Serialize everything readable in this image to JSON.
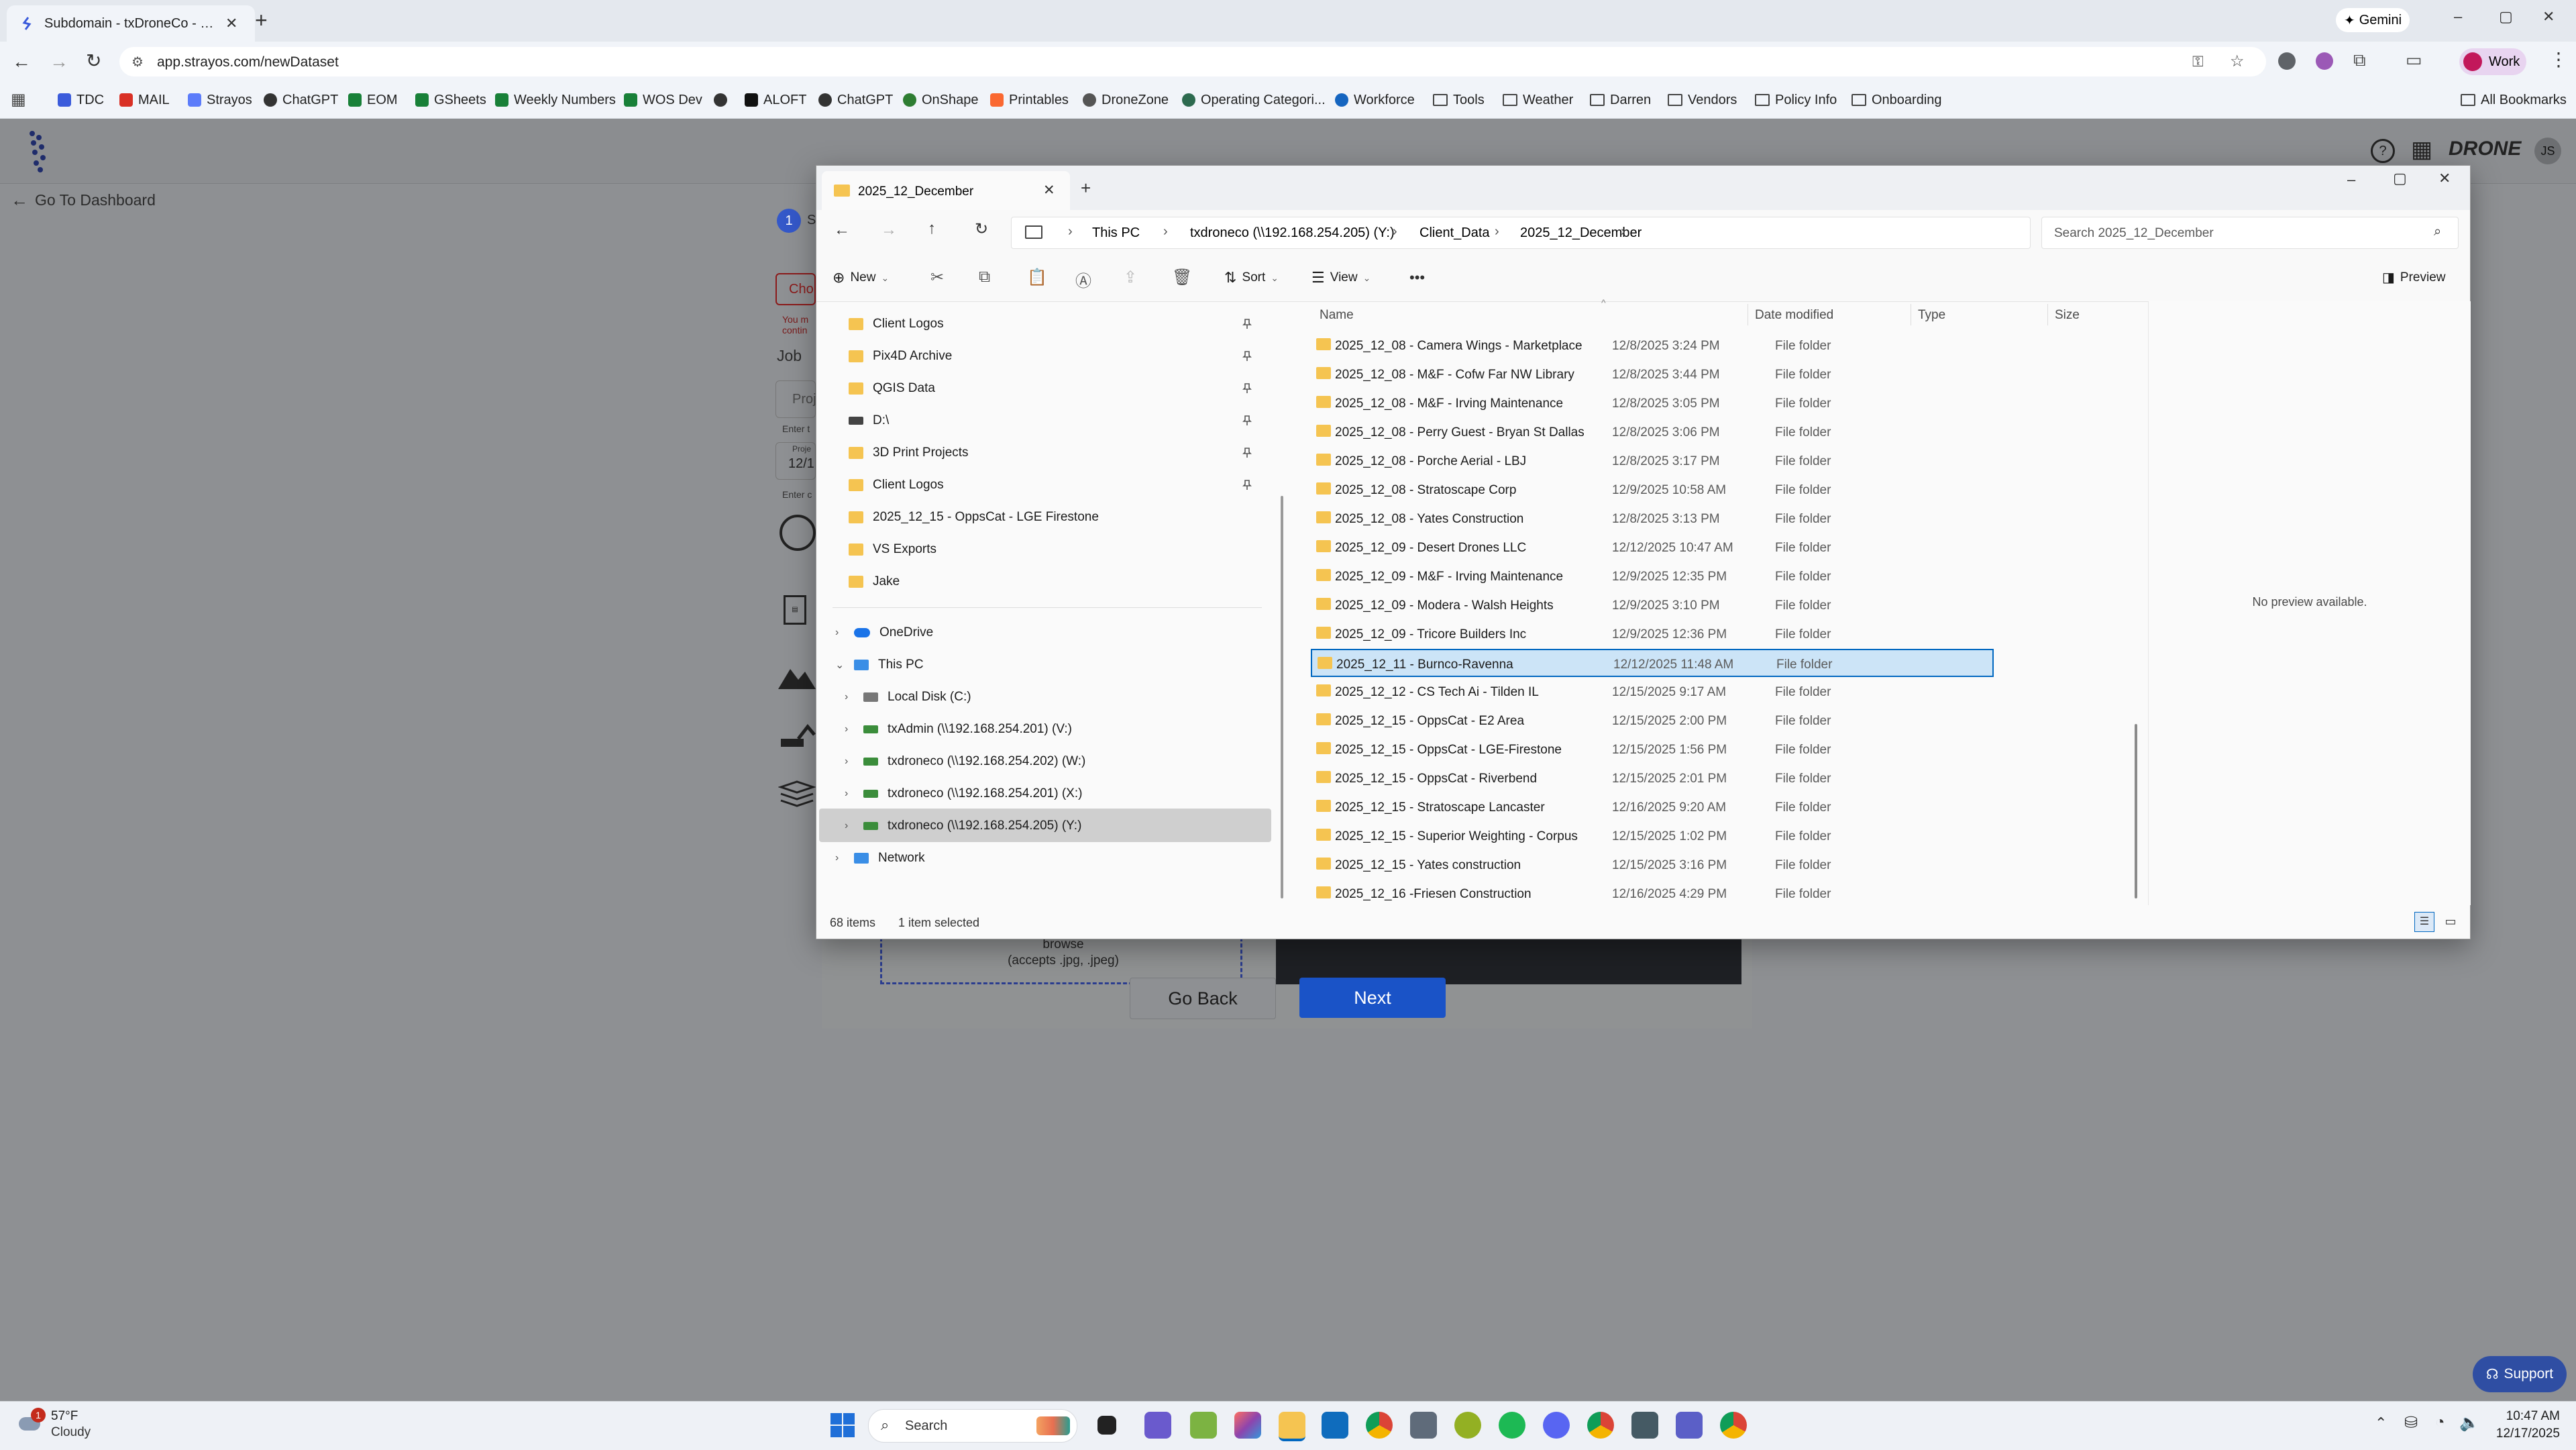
{
  "browser": {
    "tab_title": "Subdomain - txDroneCo - Dem",
    "new_tab_symbol": "+",
    "gemini_label": "Gemini",
    "url": "app.strayos.com/newDataset",
    "profile_label": "Work",
    "window_controls": [
      "–",
      "▢",
      "✕"
    ],
    "bookmarks": [
      "TDC",
      "MAIL",
      "Strayos",
      "ChatGPT",
      "EOM",
      "GSheets",
      "Weekly Numbers",
      "WOS Dev",
      "ALOFT",
      "ChatGPT",
      "OnShape",
      "Printables",
      "DroneZone",
      "Operating Categori...",
      "Workforce",
      "Tools",
      "Weather",
      "Darren",
      "Vendors",
      "Policy Info",
      "Onboarding"
    ],
    "all_bookmarks_label": "All Bookmarks"
  },
  "webpage": {
    "go_dashboard": "Go To Dashboard",
    "step_number": "1",
    "step_label_frag": "S",
    "choose_frag": "Cho",
    "warn_frag_1": "You m",
    "warn_frag_2": "contin",
    "job_label": "Job",
    "proj_placeholder_frag": "Proj",
    "enter_frag_1": "Enter t",
    "proj_label_frag": "Proje",
    "date_frag": "12/1",
    "enter_frag_2": "Enter c",
    "browse_label": "browse",
    "accepts_label": "(accepts .jpg, .jpeg)",
    "go_back_label": "Go Back",
    "next_label": "Next",
    "support_label": "Support",
    "drone_logo_text": "DRONE",
    "avatar_initials": "JS",
    "colors": {
      "accent": "#1a73e8",
      "dim_overlay": "#8e9093"
    }
  },
  "explorer": {
    "tab_title": "2025_12_December",
    "breadcrumb": [
      "This PC",
      "txdroneco (\\\\192.168.254.205) (Y:)",
      "Client_Data",
      "2025_12_December"
    ],
    "search_placeholder": "Search 2025_12_December",
    "commands": {
      "new": "New",
      "sort": "Sort",
      "view": "View",
      "more": "•••",
      "preview": "Preview"
    },
    "nav_pinned": [
      "Client Logos",
      "Pix4D Archive",
      "QGIS Data",
      "D:\\",
      "3D Print Projects",
      "Client Logos"
    ],
    "nav_recent": [
      "2025_12_15 - OppsCat - LGE Firestone",
      "VS Exports",
      "Jake"
    ],
    "nav_tree": [
      "OneDrive",
      "This PC",
      "Local Disk (C:)",
      "txAdmin (\\\\192.168.254.201) (V:)",
      "txdroneco (\\\\192.168.254.202) (W:)",
      "txdroneco (\\\\192.168.254.201) (X:)",
      "txdroneco (\\\\192.168.254.205) (Y:)",
      "Network"
    ],
    "columns": [
      "Name",
      "Date modified",
      "Type",
      "Size"
    ],
    "rows": [
      {
        "name": "2025_12_08 - Camera Wings - Marketplace",
        "date": "12/8/2025 3:24 PM",
        "type": "File folder"
      },
      {
        "name": "2025_12_08 - M&F - Cofw Far NW Library",
        "date": "12/8/2025 3:44 PM",
        "type": "File folder"
      },
      {
        "name": "2025_12_08 - M&F - Irving Maintenance",
        "date": "12/8/2025 3:05 PM",
        "type": "File folder"
      },
      {
        "name": "2025_12_08 - Perry Guest - Bryan St Dallas",
        "date": "12/8/2025 3:06 PM",
        "type": "File folder"
      },
      {
        "name": "2025_12_08 - Porche Aerial - LBJ",
        "date": "12/8/2025 3:17 PM",
        "type": "File folder"
      },
      {
        "name": "2025_12_08 - Stratoscape Corp",
        "date": "12/9/2025 10:58 AM",
        "type": "File folder"
      },
      {
        "name": "2025_12_08 - Yates Construction",
        "date": "12/8/2025 3:13 PM",
        "type": "File folder"
      },
      {
        "name": "2025_12_09 - Desert Drones LLC",
        "date": "12/12/2025 10:47 AM",
        "type": "File folder"
      },
      {
        "name": "2025_12_09 - M&F - Irving Maintenance",
        "date": "12/9/2025 12:35 PM",
        "type": "File folder"
      },
      {
        "name": "2025_12_09 - Modera - Walsh Heights",
        "date": "12/9/2025 3:10 PM",
        "type": "File folder"
      },
      {
        "name": "2025_12_09 - Tricore Builders Inc",
        "date": "12/9/2025 12:36 PM",
        "type": "File folder"
      },
      {
        "name": "2025_12_11 - Burnco-Ravenna",
        "date": "12/12/2025 11:48 AM",
        "type": "File folder"
      },
      {
        "name": "2025_12_12 - CS Tech Ai - Tilden IL",
        "date": "12/15/2025 9:17 AM",
        "type": "File folder"
      },
      {
        "name": "2025_12_15 - OppsCat - E2 Area",
        "date": "12/15/2025 2:00 PM",
        "type": "File folder"
      },
      {
        "name": "2025_12_15 - OppsCat - LGE-Firestone",
        "date": "12/15/2025 1:56 PM",
        "type": "File folder"
      },
      {
        "name": "2025_12_15 - OppsCat - Riverbend",
        "date": "12/15/2025 2:01 PM",
        "type": "File folder"
      },
      {
        "name": "2025_12_15 - Stratoscape Lancaster",
        "date": "12/16/2025 9:20 AM",
        "type": "File folder"
      },
      {
        "name": "2025_12_15 - Superior Weighting - Corpus",
        "date": "12/15/2025 1:02 PM",
        "type": "File folder"
      },
      {
        "name": "2025_12_15 - Yates construction",
        "date": "12/15/2025 3:16 PM",
        "type": "File folder"
      },
      {
        "name": "2025_12_16 -Friesen Construction",
        "date": "12/16/2025 4:29 PM",
        "type": "File folder"
      }
    ],
    "preview_text": "No preview available.",
    "status_count": "68 items",
    "status_selected": "1 item selected"
  },
  "taskbar": {
    "weather_temp": "57°F",
    "weather_desc": "Cloudy",
    "weather_badge": "1",
    "search_label": "Search",
    "time": "10:47 AM",
    "date": "12/17/2025"
  }
}
